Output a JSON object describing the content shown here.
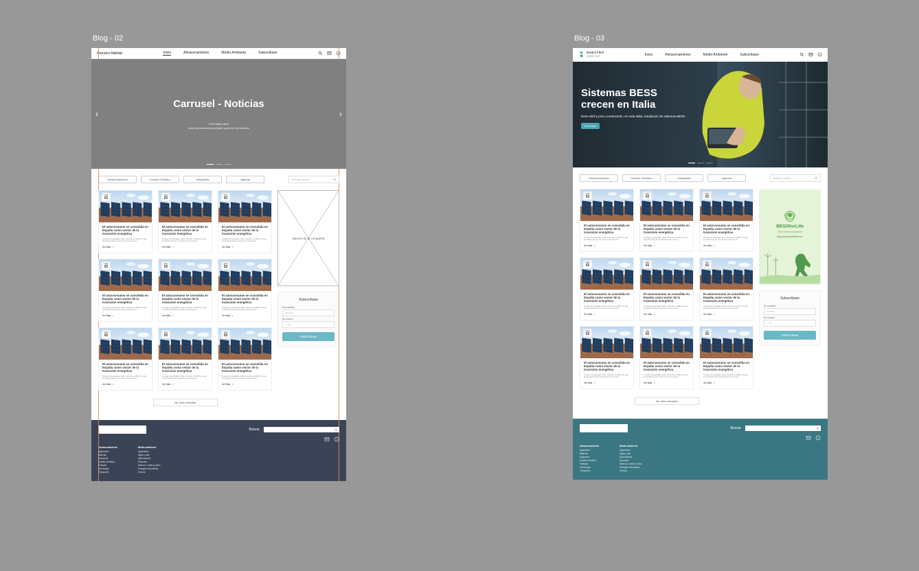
{
  "labels": {
    "a": "Blog - 02",
    "b": "Blog - 03"
  },
  "brand": {
    "a": "Nuestro Hábitat",
    "b1": "NUESTRO",
    "b2": "HÁBITAT"
  },
  "nav": {
    "home": "Inicio",
    "storage": "Almacenamiento",
    "env": "Medio Ambiente",
    "sub": "Subscribase"
  },
  "filters": {
    "f1": "Almacenamiento",
    "f2": "Cambio Climático",
    "f3": "Infografías",
    "f4": "Agenda",
    "search_ph": "Buscar noticia"
  },
  "heroA": {
    "title": "Carrusel - Noticias",
    "sub": "First Slide Label",
    "desc": "Some representative placeholder content for the first slide."
  },
  "heroB": {
    "t1": "Sistemas BESS",
    "t2": "crecen en Italia",
    "desc": "Entre abril y junio comenzarán, en toda Italia, instalación de sistemas BESS.",
    "btn": "Leer Más"
  },
  "card": {
    "month": "Ago",
    "day": "02",
    "title": "El autoconsumo se consolida en España como vector de la transición energética",
    "excerpt": "Si algo ha quedado claro durante el 2022 es que la tendencia de crecimiento del sector…",
    "more": "Ver Más"
  },
  "side": {
    "banner_ph": "Banner de la compañía",
    "ad_brand": "BESSforLife",
    "ad_tag": "The Green evolution",
    "ad_url": "http://www.bessforlife.com"
  },
  "subbox": {
    "title": "Subscríbase",
    "l_name": "Su nombre:",
    "ph_name": "Nombre",
    "l_mail": "Su correo:",
    "ph_mail": "…@…",
    "btn": "Subscríbase"
  },
  "load_more": "Ver más entradas",
  "footer": {
    "search": "Buscar",
    "colA_h": "Almacenamiento",
    "colA": [
      "Agricultura",
      "Baterías",
      "Empresas",
      "Cambio climático",
      "Políticas",
      "Tecnología",
      "Transporte"
    ],
    "colB_h": "Medio ambiente",
    "colB": [
      "Agricultura",
      "Agua y mar",
      "Alimentación",
      "Deportes",
      "Medio A. hostil al vehíc.",
      "Energías renovables",
      "Ciencia"
    ]
  }
}
